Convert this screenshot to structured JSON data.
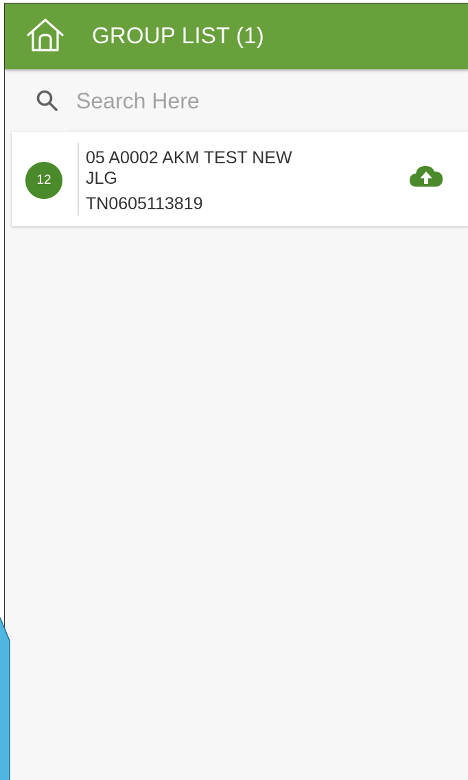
{
  "header": {
    "title": "GROUP LIST (1)",
    "icon": "home-icon",
    "background_color": "#68a03c"
  },
  "search": {
    "placeholder": "Search Here",
    "value": "",
    "icon": "search-icon"
  },
  "groups": [
    {
      "count": "12",
      "name": "05 A0002 AKM TEST NEW JLG",
      "code": "TN0605113819",
      "action_icon": "cloud-upload-icon",
      "badge_color": "#4a8a2a"
    }
  ]
}
